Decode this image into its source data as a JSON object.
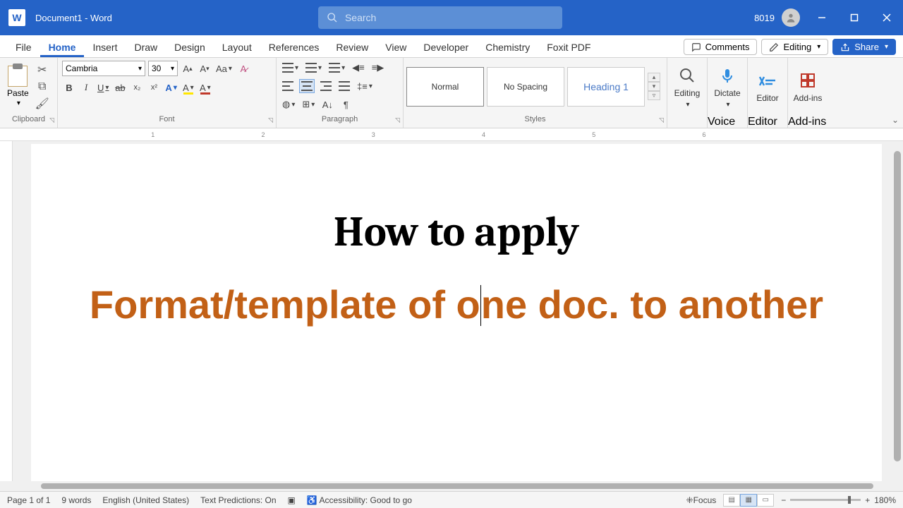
{
  "titlebar": {
    "doc": "Document1  -  Word",
    "search_placeholder": "Search",
    "user_id": "8019"
  },
  "tabs": {
    "file": "File",
    "home": "Home",
    "insert": "Insert",
    "draw": "Draw",
    "design": "Design",
    "layout": "Layout",
    "references": "References",
    "review": "Review",
    "view": "View",
    "developer": "Developer",
    "chemistry": "Chemistry",
    "foxit": "Foxit PDF"
  },
  "right_buttons": {
    "comments": "Comments",
    "editing": "Editing",
    "share": "Share"
  },
  "ribbon": {
    "clipboard": {
      "paste": "Paste",
      "label": "Clipboard"
    },
    "font": {
      "name": "Cambria",
      "size": "30",
      "label": "Font"
    },
    "paragraph": {
      "label": "Paragraph"
    },
    "styles": {
      "normal": "Normal",
      "nospacing": "No Spacing",
      "heading1": "Heading 1",
      "label": "Styles"
    },
    "editing": {
      "label": "Editing"
    },
    "voice": {
      "dictate": "Dictate",
      "label": "Voice"
    },
    "editor": {
      "editor": "Editor",
      "label": "Editor"
    },
    "addins": {
      "addins": "Add-ins",
      "label": "Add-ins"
    }
  },
  "document": {
    "line1": "How to apply",
    "line2a": "Format/template of o",
    "line2b": "ne doc. to another"
  },
  "status": {
    "page": "Page 1 of 1",
    "words": "9 words",
    "lang": "English (United States)",
    "pred": "Text Predictions: On",
    "acc": "Accessibility: Good to go",
    "focus": "Focus",
    "zoom": "180%"
  }
}
